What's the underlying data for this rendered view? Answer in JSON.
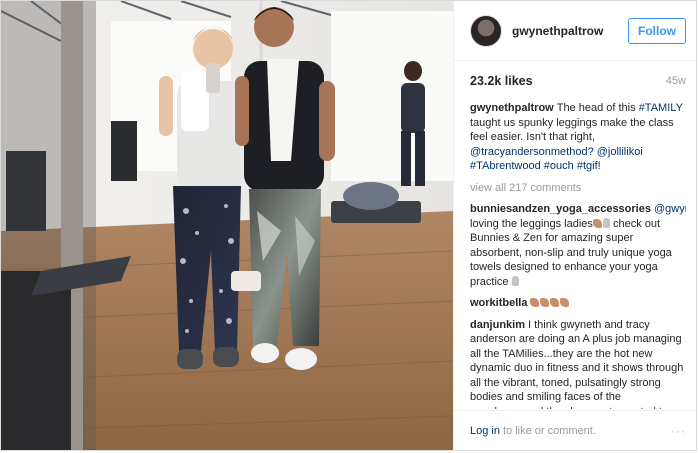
{
  "header": {
    "username": "gwynethpaltrow",
    "follow_label": "Follow"
  },
  "stats": {
    "likes": "23.2k likes",
    "age": "45w"
  },
  "caption": {
    "author": "gwynethpaltrow",
    "text_1": "The head of this ",
    "tag_1": "#TAMILY",
    "text_2": " taught us spunky leggings make the class feel easier. Isn't that right, ",
    "mention_1": "@tracyandersonmethod?",
    "text_3": " ",
    "mention_2": "@jollilikoi",
    "text_4": " ",
    "tag_2": "#TAbrentwood",
    "text_5": " ",
    "tag_3": "#ouch",
    "text_6": " ",
    "tag_4": "#tgif!"
  },
  "view_all": "view all 217 comments",
  "comments": [
    {
      "author": "bunniesandzen_yoga_accessories",
      "mention": "@gwynethpaltrow",
      "text_a": " loving the leggings ladies",
      "text_b": " check out Bunnies & Zen for amazing super absorbent, non-slip and truly unique yoga towels designed to enhance your yoga practice "
    },
    {
      "author": "workitbella",
      "text": ""
    },
    {
      "author": "danjunkim",
      "text": "I think gwyneth and tracy anderson are doing an A plus job managing all the TAMilies...they are the hot new dynamic duo in fitness and it shows through all the vibrant, toned, pulsatingly strong bodies and smiling faces of the members...and they have not resorted to putting a decapitated horse's head in any of"
    }
  ],
  "footer": {
    "login_label": "Log in",
    "rest_text": "to like or comment.",
    "more_label": "···"
  },
  "colors": {
    "follow_blue": "#3897f0",
    "link_blue": "#003569",
    "muted": "#999999"
  },
  "icons": {
    "avatar": "profile-avatar",
    "more": "more-options-icon"
  }
}
